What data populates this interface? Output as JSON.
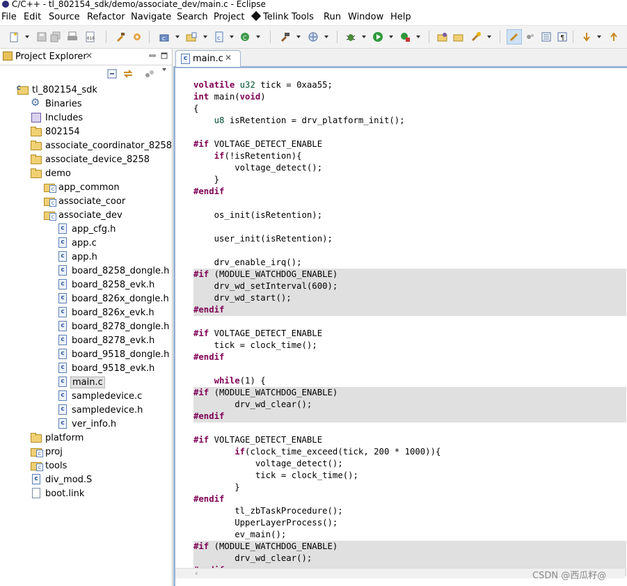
{
  "window": {
    "title": "C/C++ - tl_802154_sdk/demo/associate_dev/main.c - Eclipse"
  },
  "menu": [
    {
      "label": "File"
    },
    {
      "label": "Edit"
    },
    {
      "label": "Source"
    },
    {
      "label": "Refactor"
    },
    {
      "label": "Navigate"
    },
    {
      "label": "Search"
    },
    {
      "label": "Project"
    },
    {
      "label": "Telink Tools"
    },
    {
      "label": "Run"
    },
    {
      "label": "Window"
    },
    {
      "label": "Help"
    }
  ],
  "project_explorer": {
    "title": "Project Explorer",
    "close_glyph": "✕",
    "tree": [
      {
        "label": "tl_802154_sdk",
        "icon": "project-icon",
        "depth": 1,
        "expanded": true
      },
      {
        "label": "Binaries",
        "icon": "binaries-icon",
        "depth": 2
      },
      {
        "label": "Includes",
        "icon": "includes-icon",
        "depth": 2
      },
      {
        "label": "802154",
        "icon": "folder-icon",
        "depth": 2
      },
      {
        "label": "associate_coordinator_8258",
        "icon": "folder-icon",
        "depth": 2
      },
      {
        "label": "associate_device_8258",
        "icon": "folder-icon",
        "depth": 2
      },
      {
        "label": "demo",
        "icon": "folder-icon",
        "depth": 2,
        "expanded": true
      },
      {
        "label": "app_common",
        "icon": "source-folder-icon",
        "depth": 3
      },
      {
        "label": "associate_coor",
        "icon": "source-folder-icon",
        "depth": 3
      },
      {
        "label": "associate_dev",
        "icon": "source-folder-icon",
        "depth": 3,
        "expanded": true
      },
      {
        "label": "app_cfg.h",
        "icon": "c-file-icon",
        "depth": 4
      },
      {
        "label": "app.c",
        "icon": "c-file-icon",
        "depth": 4
      },
      {
        "label": "app.h",
        "icon": "c-file-icon",
        "depth": 4
      },
      {
        "label": "board_8258_dongle.h",
        "icon": "c-file-icon",
        "depth": 4
      },
      {
        "label": "board_8258_evk.h",
        "icon": "c-file-icon",
        "depth": 4
      },
      {
        "label": "board_826x_dongle.h",
        "icon": "c-file-icon",
        "depth": 4
      },
      {
        "label": "board_826x_evk.h",
        "icon": "c-file-icon",
        "depth": 4
      },
      {
        "label": "board_8278_dongle.h",
        "icon": "c-file-icon",
        "depth": 4
      },
      {
        "label": "board_8278_evk.h",
        "icon": "c-file-icon",
        "depth": 4
      },
      {
        "label": "board_9518_dongle.h",
        "icon": "c-file-icon",
        "depth": 4
      },
      {
        "label": "board_9518_evk.h",
        "icon": "c-file-icon",
        "depth": 4
      },
      {
        "label": "main.c",
        "icon": "c-file-icon",
        "depth": 4,
        "selected": true
      },
      {
        "label": "sampledevice.c",
        "icon": "c-file-icon",
        "depth": 4
      },
      {
        "label": "sampledevice.h",
        "icon": "c-file-icon",
        "depth": 4
      },
      {
        "label": "ver_info.h",
        "icon": "c-file-icon",
        "depth": 4
      },
      {
        "label": "platform",
        "icon": "folder-icon",
        "depth": 2
      },
      {
        "label": "proj",
        "icon": "source-folder-icon",
        "depth": 2
      },
      {
        "label": "tools",
        "icon": "source-folder-icon",
        "depth": 2
      },
      {
        "label": "div_mod.S",
        "icon": "asm-file-icon",
        "depth": 2
      },
      {
        "label": "boot.link",
        "icon": "file-icon",
        "depth": 2
      }
    ]
  },
  "editor": {
    "tab_label": "main.c",
    "close_glyph": "✕",
    "code_lines": [
      {
        "text": "volatile u32 tick = 0xaa55;",
        "hl": false
      },
      {
        "text": "int main(void)",
        "hl": false
      },
      {
        "text": "{",
        "hl": false
      },
      {
        "text": "    u8 isRetention = drv_platform_init();",
        "hl": false
      },
      {
        "text": "",
        "hl": false
      },
      {
        "text": "#if VOLTAGE_DETECT_ENABLE",
        "hl": false
      },
      {
        "text": "    if(!isRetention){",
        "hl": false
      },
      {
        "text": "        voltage_detect();",
        "hl": false
      },
      {
        "text": "    }",
        "hl": false
      },
      {
        "text": "#endif",
        "hl": false
      },
      {
        "text": "",
        "hl": false
      },
      {
        "text": "    os_init(isRetention);",
        "hl": false
      },
      {
        "text": "",
        "hl": false
      },
      {
        "text": "    user_init(isRetention);",
        "hl": false
      },
      {
        "text": "",
        "hl": false
      },
      {
        "text": "    drv_enable_irq();",
        "hl": false
      },
      {
        "text": "#if (MODULE_WATCHDOG_ENABLE)",
        "hl": true
      },
      {
        "text": "    drv_wd_setInterval(600);",
        "hl": true
      },
      {
        "text": "    drv_wd_start();",
        "hl": true
      },
      {
        "text": "#endif",
        "hl": true
      },
      {
        "text": "",
        "hl": false
      },
      {
        "text": "#if VOLTAGE_DETECT_ENABLE",
        "hl": false
      },
      {
        "text": "    tick = clock_time();",
        "hl": false
      },
      {
        "text": "#endif",
        "hl": false
      },
      {
        "text": "",
        "hl": false
      },
      {
        "text": "    while(1) {",
        "hl": false
      },
      {
        "text": "#if (MODULE_WATCHDOG_ENABLE)",
        "hl": true
      },
      {
        "text": "        drv_wd_clear();",
        "hl": true
      },
      {
        "text": "#endif",
        "hl": true
      },
      {
        "text": "",
        "hl": false
      },
      {
        "text": "#if VOLTAGE_DETECT_ENABLE",
        "hl": false
      },
      {
        "text": "        if(clock_time_exceed(tick, 200 * 1000)){",
        "hl": false
      },
      {
        "text": "            voltage_detect();",
        "hl": false
      },
      {
        "text": "            tick = clock_time();",
        "hl": false
      },
      {
        "text": "        }",
        "hl": false
      },
      {
        "text": "#endif",
        "hl": false
      },
      {
        "text": "        tl_zbTaskProcedure();",
        "hl": false
      },
      {
        "text": "        UpperLayerProcess();",
        "hl": false
      },
      {
        "text": "        ev_main();",
        "hl": false
      },
      {
        "text": "#if (MODULE_WATCHDOG_ENABLE)",
        "hl": true
      },
      {
        "text": "        drv_wd_clear();",
        "hl": true
      },
      {
        "text": "#endif",
        "hl": true
      }
    ]
  },
  "watermark": "CSDN @西瓜籽@",
  "colors": {
    "keyword": "#7f0055",
    "type": "#005032",
    "highlight": "#e0e0e0",
    "tab_border": "#9bb4d6"
  }
}
